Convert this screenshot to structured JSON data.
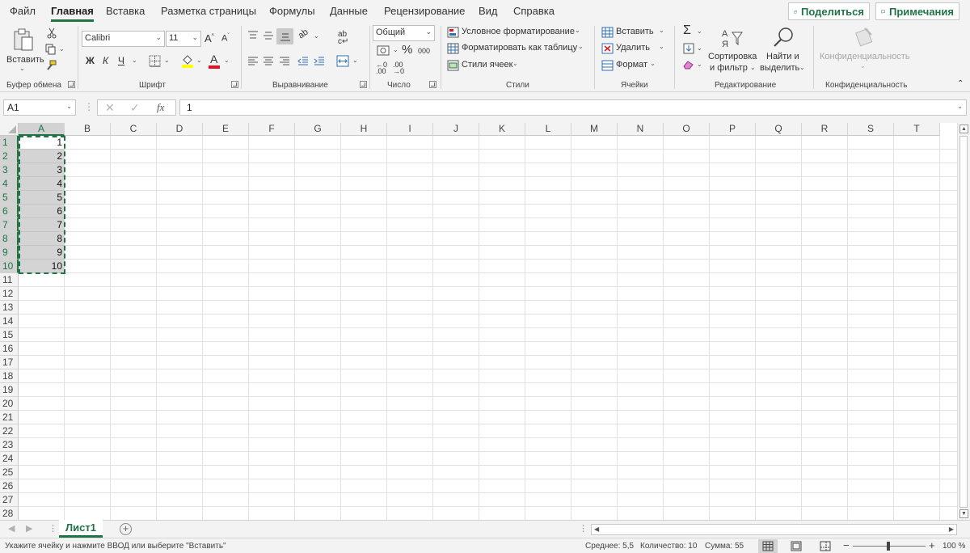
{
  "menu": {
    "tabs": [
      "Файл",
      "Главная",
      "Вставка",
      "Разметка страницы",
      "Формулы",
      "Данные",
      "Рецензирование",
      "Вид",
      "Справка"
    ],
    "active_tab": "Главная",
    "share_label": "Поделиться",
    "comments_label": "Примечания"
  },
  "ribbon": {
    "clipboard": {
      "paste_label": "Вставить",
      "group_label": "Буфер обмена"
    },
    "font": {
      "font_name": "Calibri",
      "font_size": "11",
      "bold": "Ж",
      "italic": "К",
      "underline": "Ч",
      "group_label": "Шрифт"
    },
    "alignment": {
      "group_label": "Выравнивание"
    },
    "number": {
      "format": "Общий",
      "percent": "%",
      "thousands": "000",
      "group_label": "Число"
    },
    "styles": {
      "conditional": "Условное форматирование",
      "format_table": "Форматировать как таблицу",
      "cell_styles": "Стили ячеек",
      "group_label": "Стили"
    },
    "cells": {
      "insert": "Вставить",
      "delete": "Удалить",
      "format": "Формат",
      "group_label": "Ячейки"
    },
    "editing": {
      "sort_line1": "Сортировка",
      "sort_line2": "и фильтр",
      "find_line1": "Найти и",
      "find_line2": "выделить",
      "group_label": "Редактирование"
    },
    "sensitivity": {
      "button_label": "Конфиденциальность",
      "group_label": "Конфиденциальность"
    }
  },
  "formula_bar": {
    "name_box": "A1",
    "fx": "fx",
    "content": "1"
  },
  "grid": {
    "columns": [
      "A",
      "B",
      "C",
      "D",
      "E",
      "F",
      "G",
      "H",
      "I",
      "J",
      "K",
      "L",
      "M",
      "N",
      "O",
      "P",
      "Q",
      "R",
      "S",
      "T"
    ],
    "rows": [
      "1",
      "2",
      "3",
      "4",
      "5",
      "6",
      "7",
      "8",
      "9",
      "10",
      "11",
      "12",
      "13",
      "14",
      "15",
      "16",
      "17",
      "18",
      "19",
      "20",
      "21",
      "22",
      "23",
      "24",
      "25",
      "26",
      "27",
      "28"
    ],
    "column_a_values": [
      "1",
      "2",
      "3",
      "4",
      "5",
      "6",
      "7",
      "8",
      "9",
      "10"
    ],
    "selected_column": "A",
    "selected_rows": 10
  },
  "sheets": {
    "tabs": [
      "Лист1"
    ]
  },
  "status": {
    "message": "Укажите ячейку и нажмите ВВОД или выберите \"Вставить\"",
    "average": "Среднее: 5,5",
    "count": "Количество: 10",
    "sum": "Сумма: 55",
    "zoom": "100 %"
  },
  "colors": {
    "accent": "#217346",
    "selection": "#d4d4d4",
    "font_color_bar": "#e81123",
    "highlight_bar": "#ffff00"
  }
}
